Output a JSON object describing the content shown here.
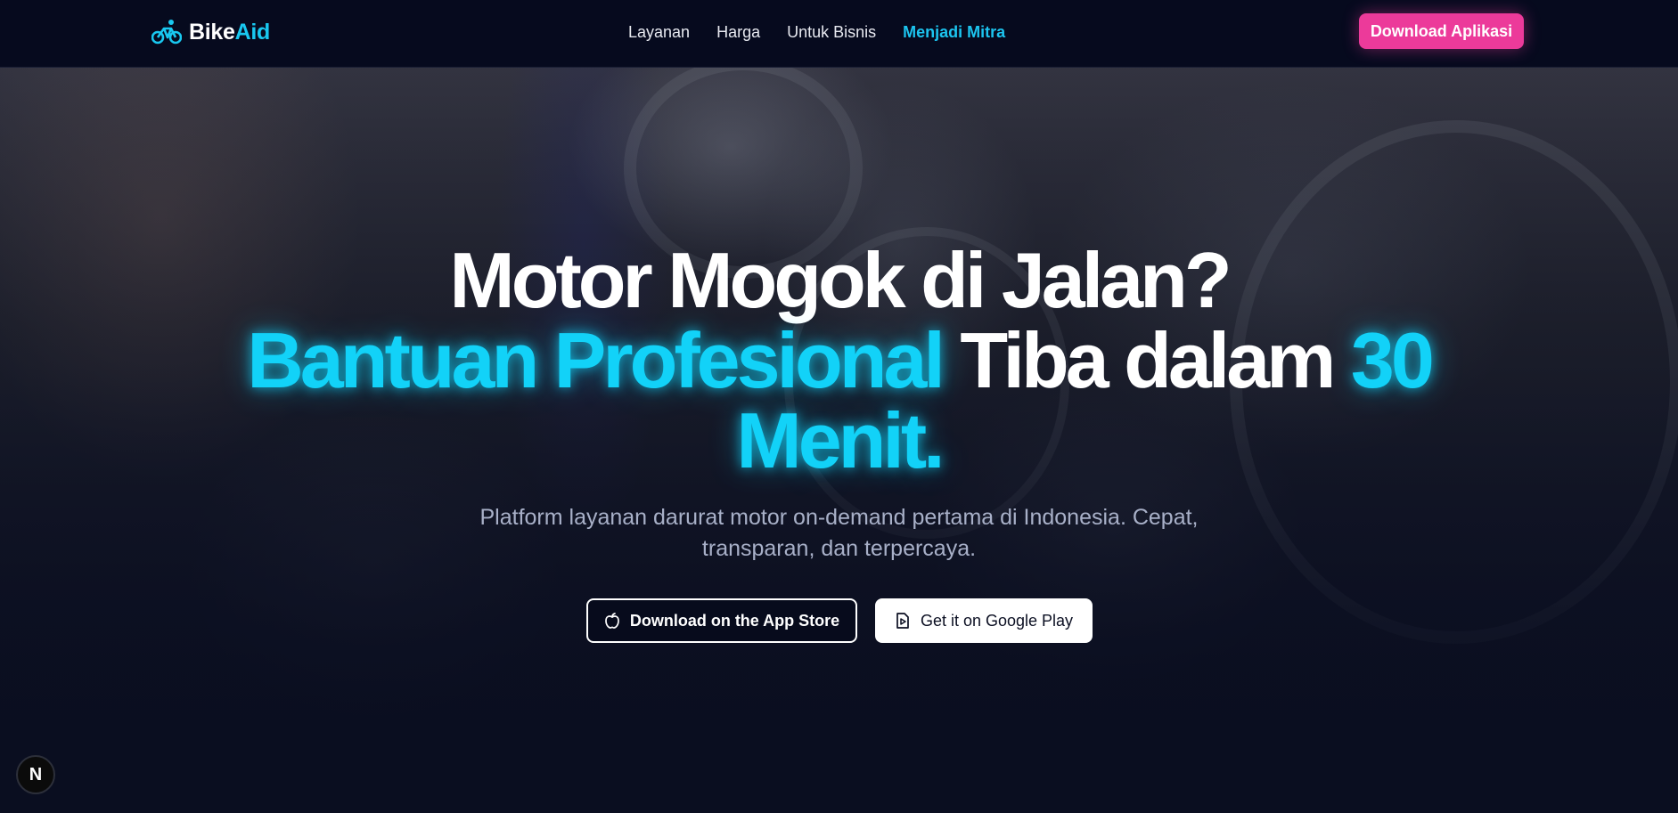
{
  "brand": {
    "name_part1": "Bike",
    "name_part2": "Aid",
    "accent_color": "#19c8f0",
    "icon": "bicycle-icon"
  },
  "nav": {
    "items": [
      {
        "label": "Layanan",
        "active": false
      },
      {
        "label": "Harga",
        "active": false
      },
      {
        "label": "Untuk Bisnis",
        "active": false
      },
      {
        "label": "Menjadi Mitra",
        "active": true
      }
    ],
    "cta_label": "Download Aplikasi",
    "cta_color": "#ec3a9a"
  },
  "hero": {
    "headline_line1": "Motor Mogok di Jalan?",
    "headline_cyan1": "Bantuan Profesional",
    "headline_white2": " Tiba dalam ",
    "headline_cyan2": "30",
    "headline_cyan3": "Menit.",
    "subtitle": "Platform layanan darurat motor on-demand pertama di Indonesia. Cepat, transparan, dan terpercaya.",
    "app_store_label": "Download on the App Store",
    "app_store_icon": "apple-icon",
    "google_play_label": "Get it on Google Play",
    "google_play_icon": "play-store-icon",
    "highlight_color": "#12d2f8"
  },
  "badge": {
    "letter": "N"
  }
}
